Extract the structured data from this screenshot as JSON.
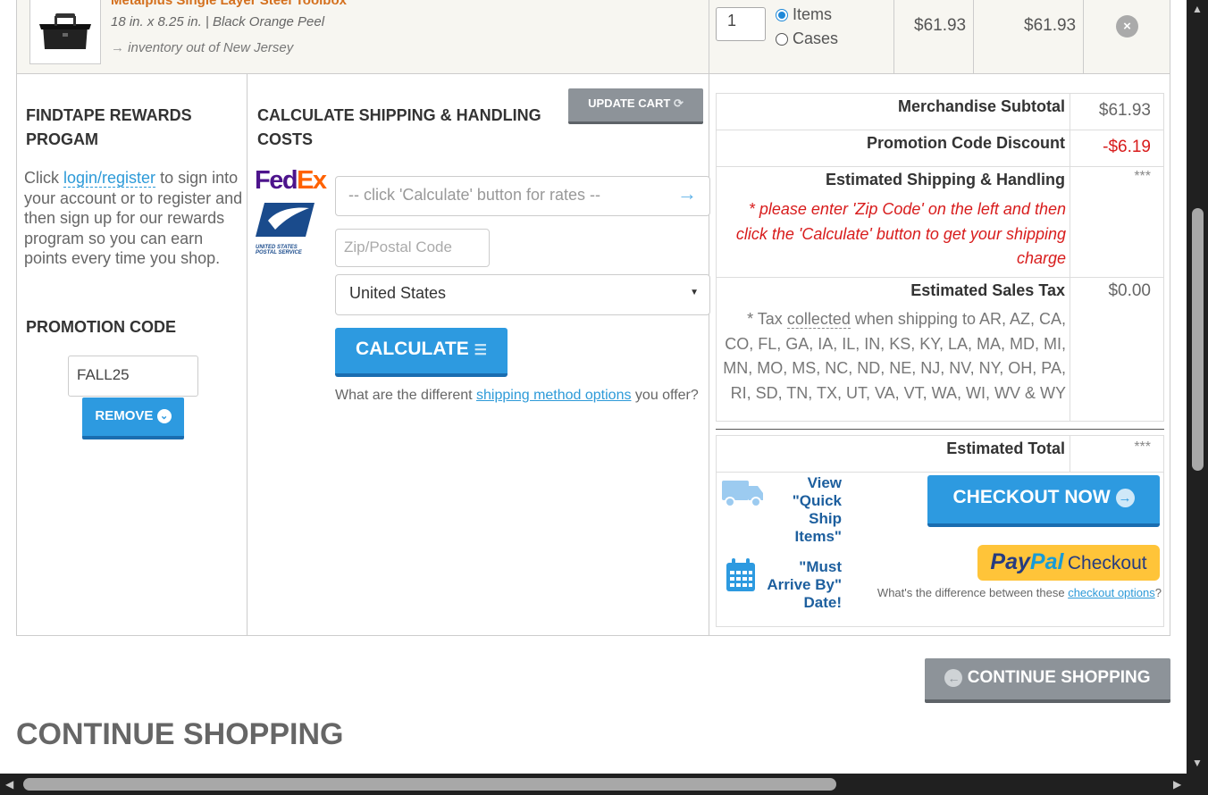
{
  "item": {
    "title": "Metalplus Single Layer Steel Toolbox",
    "dimensions": "18 in. x 8.25 in. | Black Orange Peel",
    "inventory": "inventory out of New Jersey",
    "quantity": "1",
    "unit_items": "Items",
    "unit_cases": "Cases",
    "unit_price": "$61.93",
    "total_price": "$61.93"
  },
  "rewards": {
    "heading_line1": "FINDTAPE REWARDS",
    "heading_line2": "PROGAM",
    "text_before": "Click ",
    "link": "login/register",
    "text_after": " to sign into your account or to register and then sign up for our rewards program so you can earn points every time you shop."
  },
  "promo": {
    "heading": "PROMOTION CODE",
    "code": "FALL25",
    "remove_label": "REMOVE"
  },
  "shipping": {
    "heading_line1": "CALCULATE SHIPPING & HANDLING",
    "heading_line2": "COSTS",
    "update_cart": "UPDATE CART",
    "rates_placeholder": "-- click 'Calculate' button for rates --",
    "zip_placeholder": "Zip/Postal Code",
    "country": "United States",
    "calculate": "CALCULATE",
    "help_before": "What are the different ",
    "help_link": "shipping method options",
    "help_after": " you offer?",
    "fedex_fed": "Fed",
    "fedex_ex": "Ex",
    "usps_text": "UNITED STATES POSTAL SERVICE"
  },
  "summary": {
    "subtotal_label": "Merchandise Subtotal",
    "subtotal_value": "$61.93",
    "discount_label": "Promotion Code Discount",
    "discount_value": "-$6.19",
    "shipping_label": "Estimated Shipping & Handling",
    "shipping_value": "***",
    "shipping_note": "* please enter 'Zip Code' on the left and then click the 'Calculate' button to get your shipping charge",
    "tax_label": "Estimated Sales Tax",
    "tax_value": "$0.00",
    "tax_note_before": "* Tax ",
    "tax_note_link": "collected",
    "tax_note_after": " when shipping to AR, AZ, CA, CO, FL, GA, IA, IL, IN, KS, KY, LA, MA, MD, MI, MN, MO, MS, NC, ND, NE, NJ, NV, NY, OH, PA, RI, SD, TN, TX, UT, VA, VT, WA, WI, WV & WY",
    "total_label": "Estimated Total",
    "total_value": "***"
  },
  "checkout": {
    "quick_ship": "View \"Quick Ship Items\"",
    "must_arrive": "\"Must Arrive By\" Date!",
    "checkout_now": "CHECKOUT NOW",
    "paypal_pay": "Pay",
    "paypal_pal": "Pal",
    "paypal_checkout": "Checkout",
    "diff_before": "What's the difference between these ",
    "diff_link": "checkout options",
    "diff_after": "?"
  },
  "continue_button": "CONTINUE SHOPPING",
  "continue_heading": "CONTINUE SHOPPING",
  "colors": {
    "accent": "#2d9ae0",
    "orange": "#d4701e",
    "red": "#d81c1c",
    "link": "#2d9ad8"
  }
}
